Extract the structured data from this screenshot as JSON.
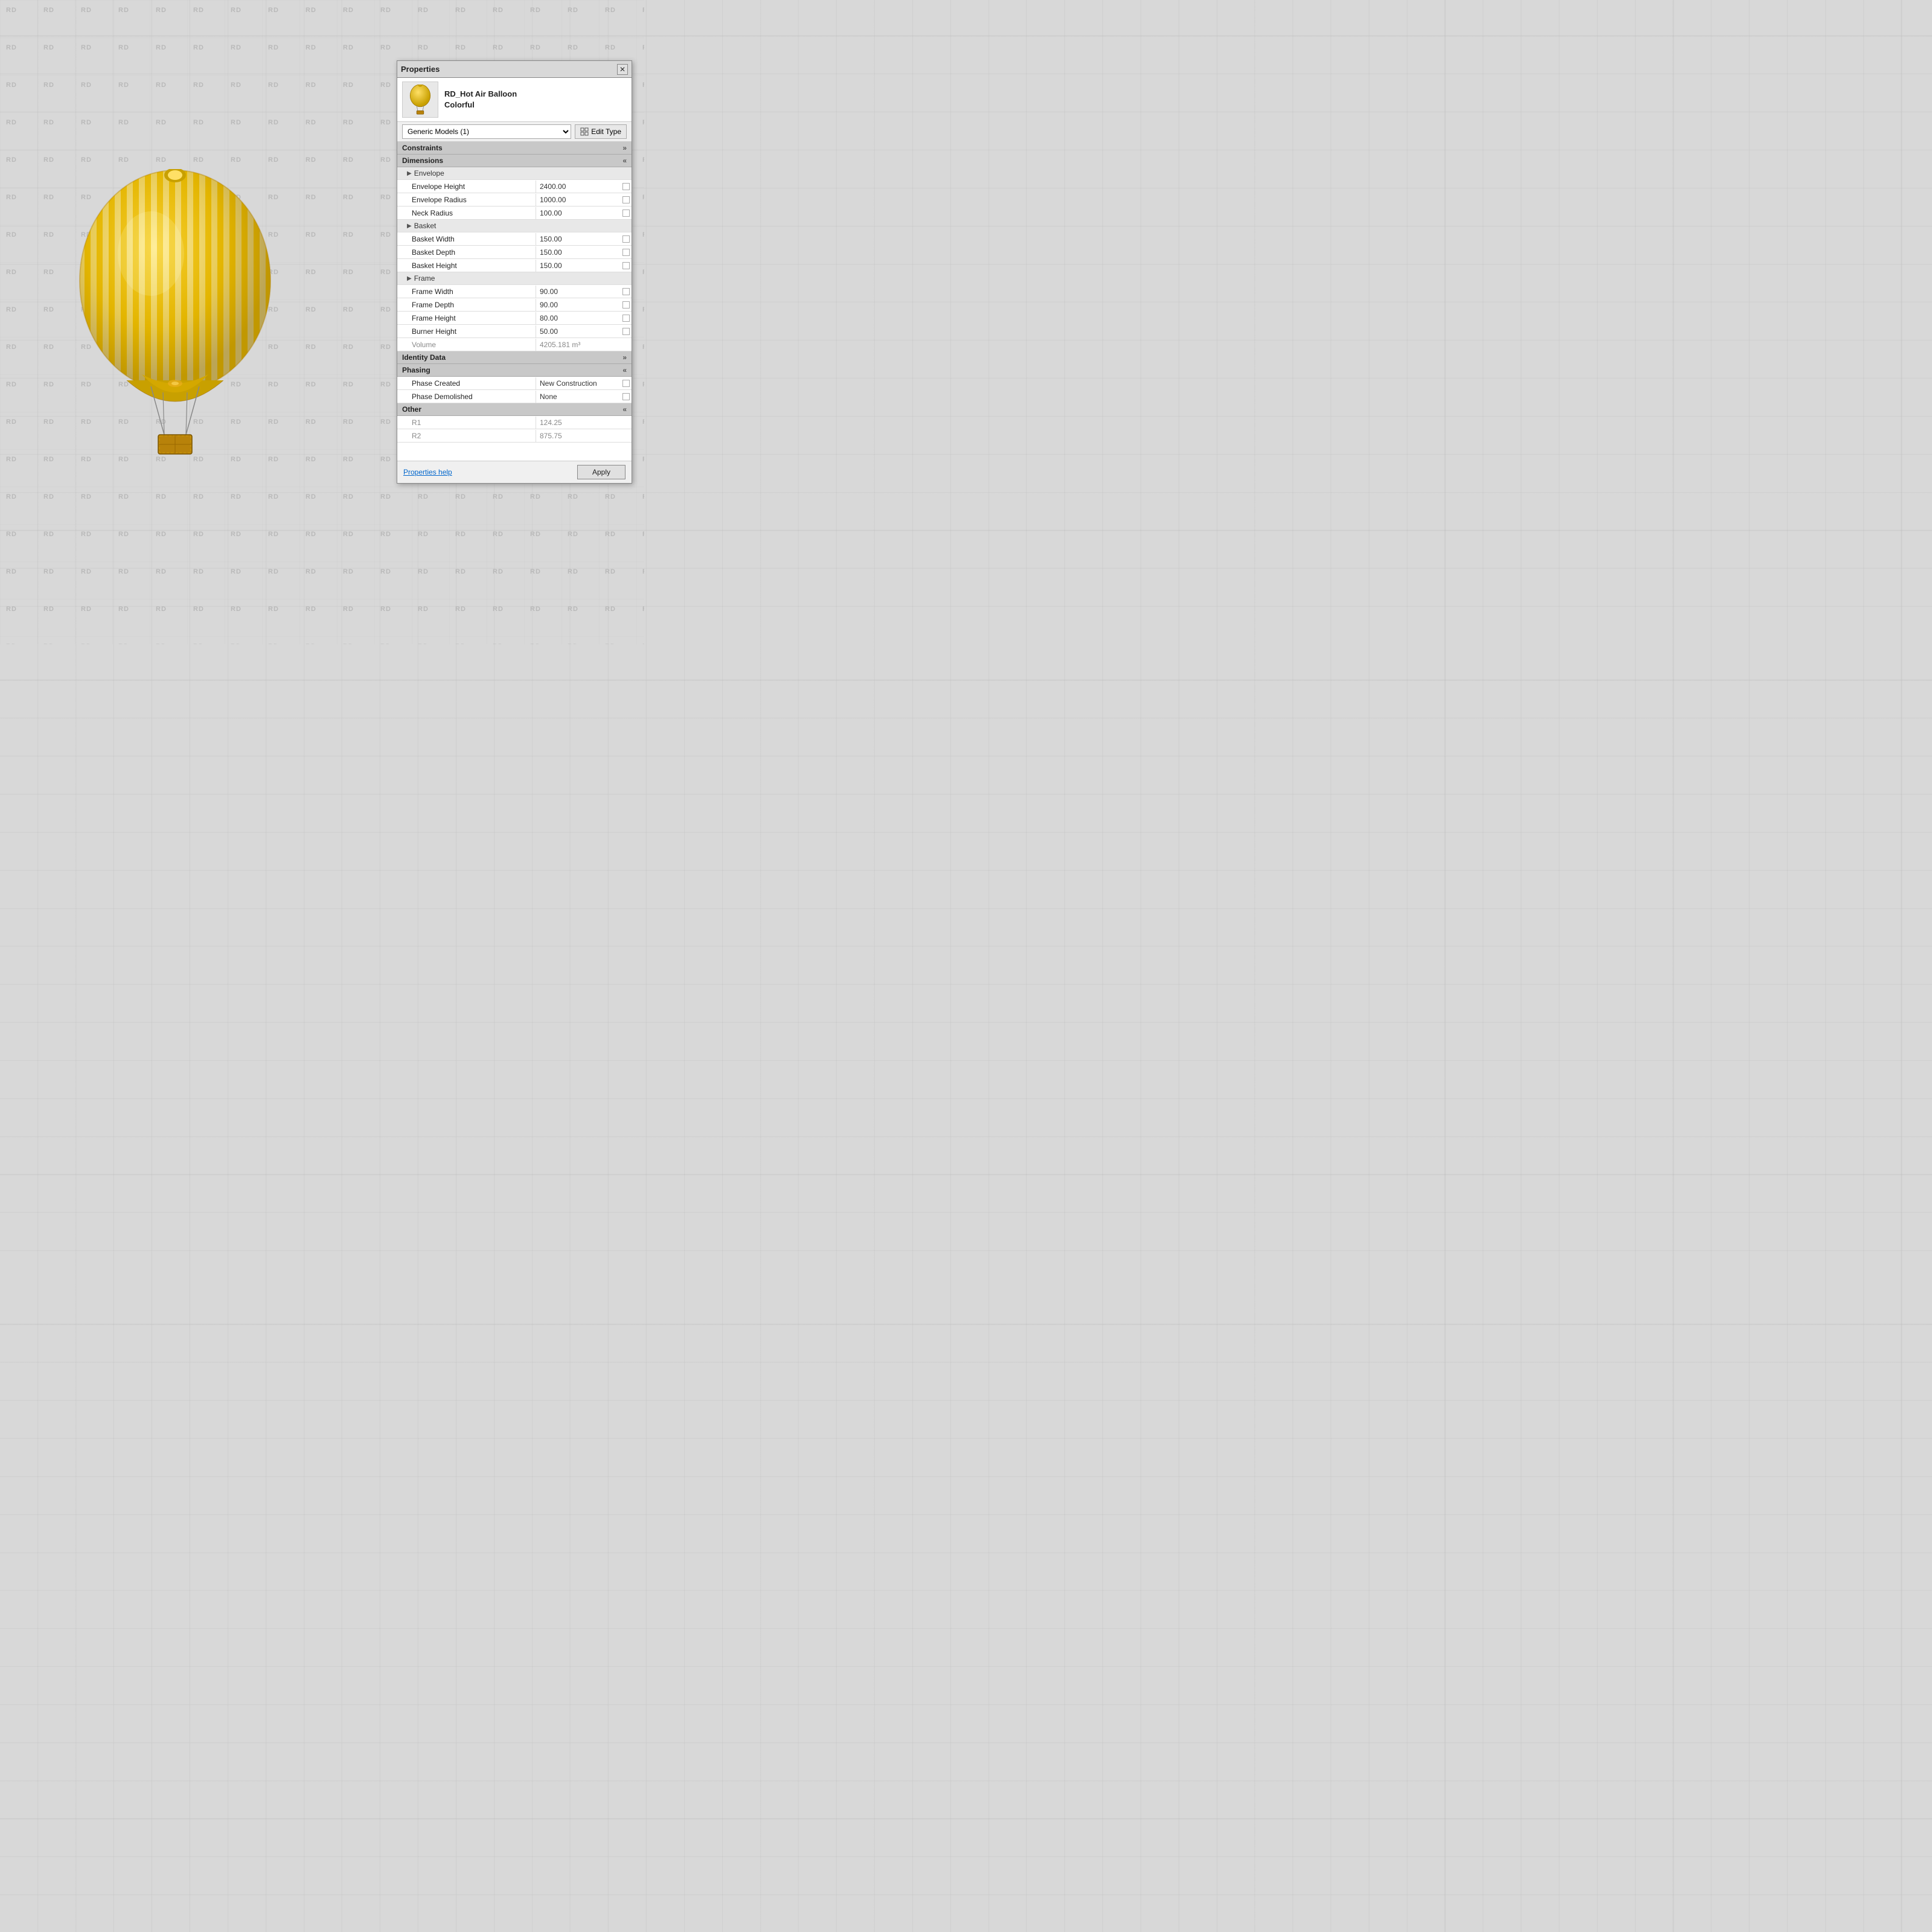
{
  "watermark": {
    "text": "RD"
  },
  "panel": {
    "title": "Properties",
    "close_label": "✕",
    "item_name_line1": "RD_Hot Air Balloon",
    "item_name_line2": "Colorful",
    "dropdown_value": "Generic Models (1)",
    "edit_type_label": "Edit Type",
    "sections": {
      "constraints": {
        "label": "Constraints",
        "chevron": "»"
      },
      "dimensions": {
        "label": "Dimensions",
        "chevron": "«"
      },
      "identity_data": {
        "label": "Identity Data",
        "chevron": "»"
      },
      "phasing": {
        "label": "Phasing",
        "chevron": "«"
      },
      "other": {
        "label": "Other",
        "chevron": "«"
      }
    },
    "sub_sections": {
      "envelope": "Envelope",
      "basket": "Basket",
      "frame": "Frame"
    },
    "properties": [
      {
        "label": "Envelope Height",
        "value": "2400.00",
        "readonly": false
      },
      {
        "label": "Envelope Radius",
        "value": "1000.00",
        "readonly": false
      },
      {
        "label": "Neck Radius",
        "value": "100.00",
        "readonly": false
      },
      {
        "label": "Basket Width",
        "value": "150.00",
        "readonly": false
      },
      {
        "label": "Basket Depth",
        "value": "150.00",
        "readonly": false
      },
      {
        "label": "Basket Height",
        "value": "150.00",
        "readonly": false
      },
      {
        "label": "Frame Width",
        "value": "90.00",
        "readonly": false
      },
      {
        "label": "Frame Depth",
        "value": "90.00",
        "readonly": false
      },
      {
        "label": "Frame Height",
        "value": "80.00",
        "readonly": false
      },
      {
        "label": "Burner Height",
        "value": "50.00",
        "readonly": false
      },
      {
        "label": "Volume",
        "value": "4205.181 m³",
        "readonly": true
      },
      {
        "label": "Phase Created",
        "value": "New Construction",
        "readonly": false
      },
      {
        "label": "Phase Demolished",
        "value": "None",
        "readonly": false
      },
      {
        "label": "R1",
        "value": "124.25",
        "readonly": true
      },
      {
        "label": "R2",
        "value": "875.75",
        "readonly": true
      }
    ],
    "footer": {
      "help_label": "Properties help",
      "apply_label": "Apply"
    }
  }
}
